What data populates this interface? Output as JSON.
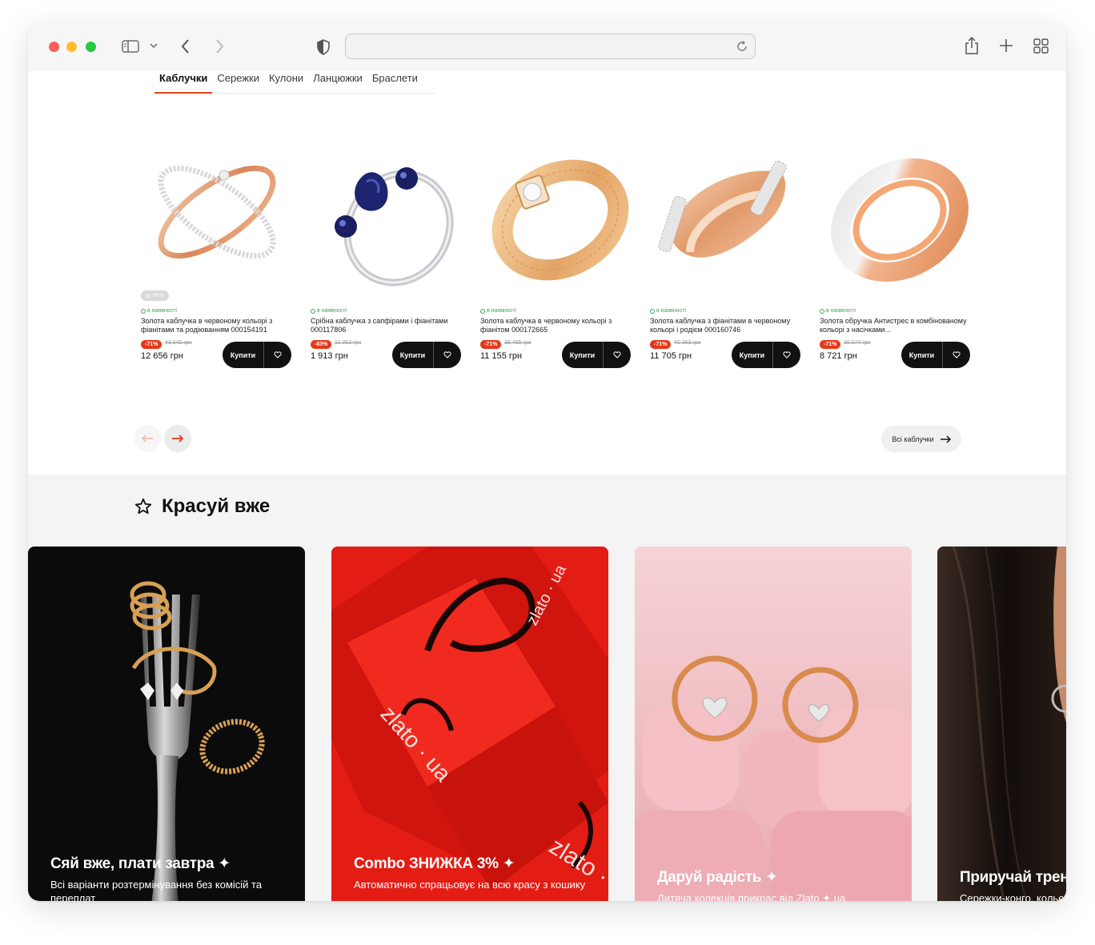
{
  "browser": {
    "url": "",
    "icons": [
      "sidebar-toggle-icon",
      "chevron-down-icon",
      "back-icon",
      "forward-icon",
      "shield-icon",
      "reload-icon",
      "share-icon",
      "new-tab-icon",
      "tab-overview-icon"
    ]
  },
  "category_tabs": [
    {
      "label": "Каблучки",
      "active": true
    },
    {
      "label": "Сережки",
      "active": false
    },
    {
      "label": "Кулони",
      "active": false
    },
    {
      "label": "Ланцюжки",
      "active": false
    },
    {
      "label": "Браслети",
      "active": false
    }
  ],
  "products": [
    {
      "badge": "New",
      "stock": "в наявності",
      "name": "Золота каблучка в червоному кольорі з фіанітами та родіюванням 000154191",
      "discount": "-71%",
      "old_price": "43 640 грн",
      "price": "12 656 грн",
      "buy_label": "Купити"
    },
    {
      "badge": "",
      "stock": "в наявності",
      "name": "Срібна каблучка з сапфірами і фіанітами 000117806",
      "discount": "-83%",
      "old_price": "11 253 грн",
      "price": "1 913 грн",
      "buy_label": "Купити"
    },
    {
      "badge": "",
      "stock": "в наявності",
      "name": "Золота каблучка в червоному кольорі з фіанітом 000172665",
      "discount": "-71%",
      "old_price": "38 465 грн",
      "price": "11 155 грн",
      "buy_label": "Купити"
    },
    {
      "badge": "",
      "stock": "в наявності",
      "name": "Золота каблучка з фіанітами в червоному кольорі і родієм 000160746",
      "discount": "-71%",
      "old_price": "40 363 грн",
      "price": "11 705 грн",
      "buy_label": "Купити"
    },
    {
      "badge": "",
      "stock": "в наявності",
      "name": "Золота обручка Антистрес в комбінованому кольорі з насічками...",
      "discount": "-71%",
      "old_price": "30 074 грн",
      "price": "8 721 грн",
      "buy_label": "Купити"
    }
  ],
  "carousel": {
    "all_label": "Всі каблучки"
  },
  "section": {
    "title": "Красуй вже"
  },
  "promos": [
    {
      "title": "Сяй вже, плати завтра ✦",
      "text": "Всі варіанти розтермінування без комісій та переплат"
    },
    {
      "title": "Combo ЗНИЖКА 3% ✦",
      "text": "Автоматично спрацьовує на всю красу з кошику"
    },
    {
      "title": "Даруй радість ✦",
      "text": "Дитяча колекція прикрас від Zlato ✦ ua"
    },
    {
      "title": "Приручай тренди ✦",
      "text": "Сережки-конго, кольє та інші"
    }
  ],
  "colors": {
    "accent": "#e2401c",
    "stock_green": "#3ca84a",
    "discount": "#e6381a",
    "dark": "#111111"
  }
}
